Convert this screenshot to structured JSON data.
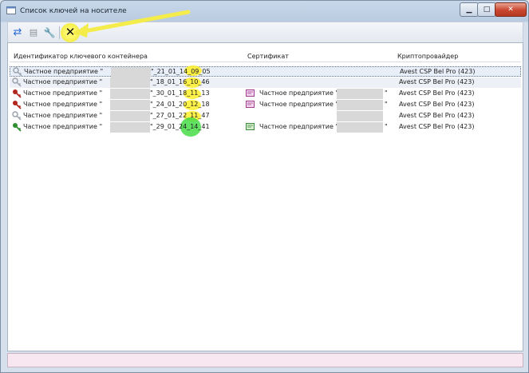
{
  "window": {
    "title": "Список ключей на носителе",
    "min": "▁",
    "max": "□",
    "close": "✕"
  },
  "toolbar": {
    "refresh": "⇄",
    "props": "▤",
    "key": "🔧",
    "delete": "✕"
  },
  "columns": {
    "id": "Идентификатор ключевого контейнера",
    "cert": "Сертификат",
    "provider": "Криптопровайдер"
  },
  "rows": [
    {
      "id_left": "Частное предприятие \"",
      "id_right": "\"_21_01_14_09_05",
      "cert": "",
      "provider": "Avest CSP Bel Pro (423)",
      "icon": "key-gray"
    },
    {
      "id_left": "Частное предприятие \"",
      "id_right": "\"_18_01_16_10_46",
      "cert": "",
      "provider": "Avest CSP Bel Pro (423)",
      "icon": "key-gray"
    },
    {
      "id_left": "Частное предприятие \"",
      "id_right": "\"_30_01_18_11_13",
      "cert": "Частное предприятие \"",
      "cert_right": "\"",
      "provider": "Avest CSP Bel Pro (423)",
      "icon": "key-red"
    },
    {
      "id_left": "Частное предприятие \"",
      "id_right": "\"_24_01_20_12_18",
      "cert": "Частное предприятие \"",
      "cert_right": "\"",
      "provider": "Avest CSP Bel Pro (423)",
      "icon": "key-red"
    },
    {
      "id_left": "Частное предприятие \"",
      "id_right": "\"_27_01_22_11_47",
      "cert": "",
      "provider": "Avest CSP Bel Pro (423)",
      "icon": "key-gray"
    },
    {
      "id_left": "Частное предприятие \"",
      "id_right": "\"_29_01_24_14_41",
      "cert": "Частное предприятие \"",
      "cert_right": "\"",
      "provider": "Avest CSP Bel Pro (423)",
      "icon": "key-green"
    }
  ],
  "colors": {
    "key_gray": "#9aa2ad",
    "key_red": "#b3261e",
    "key_green": "#2f8f2f",
    "highlight_yellow": "#fff03c",
    "highlight_green": "#46dc46"
  }
}
